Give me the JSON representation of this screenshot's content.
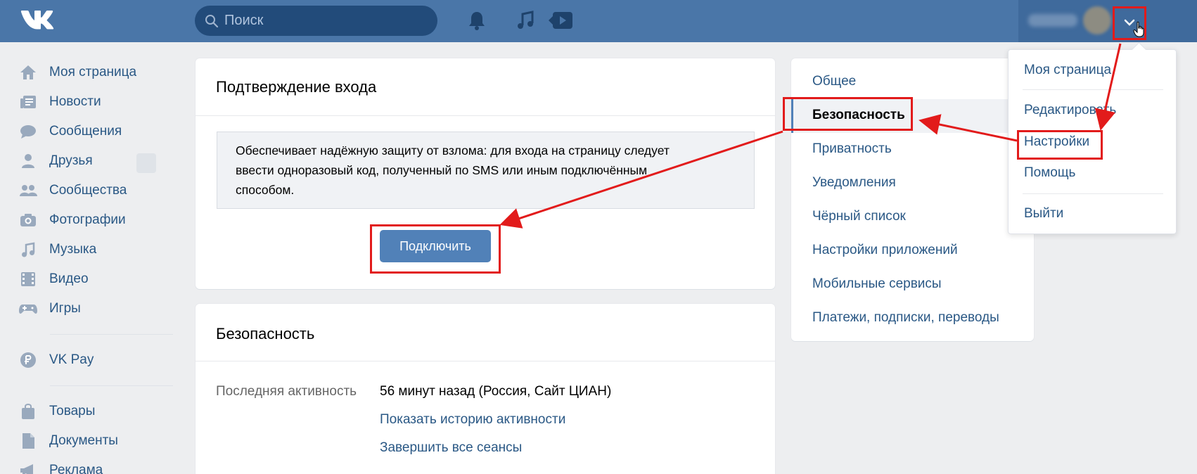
{
  "header": {
    "search_placeholder": "Поиск"
  },
  "leftnav": {
    "items": [
      {
        "label": "Моя страница",
        "icon": "home-icon"
      },
      {
        "label": "Новости",
        "icon": "news-icon"
      },
      {
        "label": "Сообщения",
        "icon": "messages-icon"
      },
      {
        "label": "Друзья",
        "icon": "friends-icon"
      },
      {
        "label": "Сообщества",
        "icon": "communities-icon"
      },
      {
        "label": "Фотографии",
        "icon": "camera-icon"
      },
      {
        "label": "Музыка",
        "icon": "music-icon"
      },
      {
        "label": "Видео",
        "icon": "video-icon"
      },
      {
        "label": "Игры",
        "icon": "gamepad-icon"
      }
    ],
    "pay": {
      "label": "VK Pay",
      "icon": "vkpay-icon"
    },
    "extra": [
      {
        "label": "Товары",
        "icon": "bag-icon"
      },
      {
        "label": "Документы",
        "icon": "document-icon"
      },
      {
        "label": "Реклама",
        "icon": "megaphone-icon"
      }
    ]
  },
  "login_confirm": {
    "title": "Подтверждение входа",
    "description_lines": [
      "Обеспечивает надёжную защиту от взлома: для входа на страницу следует",
      "ввести одноразовый код, полученный по SMS или иным подключённым",
      "способом."
    ],
    "button": "Подключить"
  },
  "security": {
    "title": "Безопасность",
    "last_activity_label": "Последняя активность",
    "last_activity_value": "56 минут назад (Россия, Сайт ЦИАН)",
    "history_link": "Показать историю активности",
    "end_sessions_link": "Завершить все сеансы"
  },
  "settings_menu": {
    "items": [
      "Общее",
      "Безопасность",
      "Приватность",
      "Уведомления",
      "Чёрный список",
      "Настройки приложений",
      "Мобильные сервисы",
      "Платежи, подписки, переводы"
    ],
    "active": "Безопасность"
  },
  "dropdown": {
    "items": [
      "Моя страница",
      "Редактировать",
      "Настройки",
      "Помощь",
      "Выйти"
    ]
  },
  "colors": {
    "header": "#4a76a8",
    "link": "#2a5885",
    "button": "#5181b8",
    "highlight": "#e21b1b"
  }
}
